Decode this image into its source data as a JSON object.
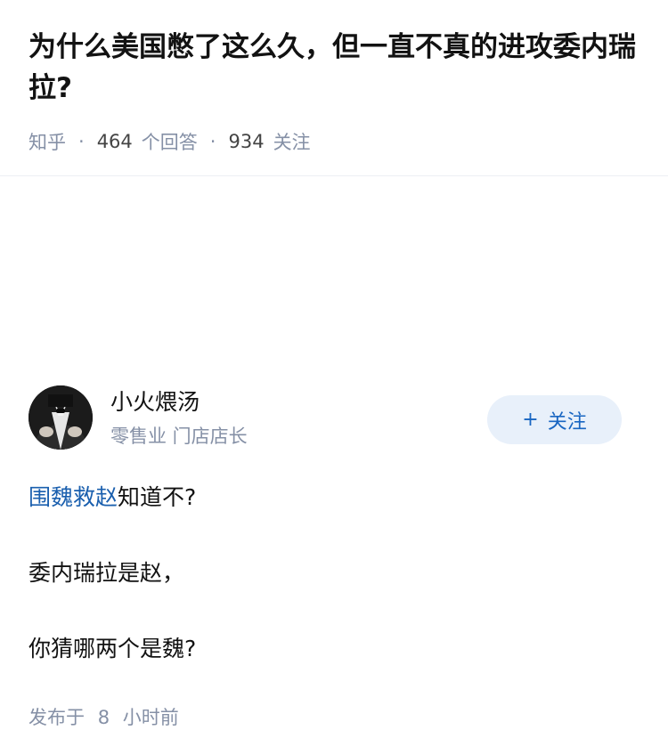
{
  "question": {
    "title": "为什么美国憋了这么久，但一直不真的进攻委内瑞拉?",
    "source": "知乎",
    "separator": "·",
    "answer_count": "464",
    "answer_label": "个回答",
    "follow_count": "934",
    "follow_label": "关注"
  },
  "author": {
    "name": "小火煨汤",
    "headline": "零售业 门店店长",
    "follow_button": {
      "icon": "+",
      "label": "关注"
    }
  },
  "answer": {
    "p1_link": "围魏救赵",
    "p1_rest": "知道不?",
    "p2": "委内瑞拉是赵，",
    "p3": "你猜哪两个是魏?",
    "publish_prefix": "发布于",
    "publish_num": "8",
    "publish_suffix": "小时前"
  },
  "colors": {
    "accent": "#1966c2",
    "meta": "#8590a6",
    "follow_bg": "#e8f0fa"
  }
}
